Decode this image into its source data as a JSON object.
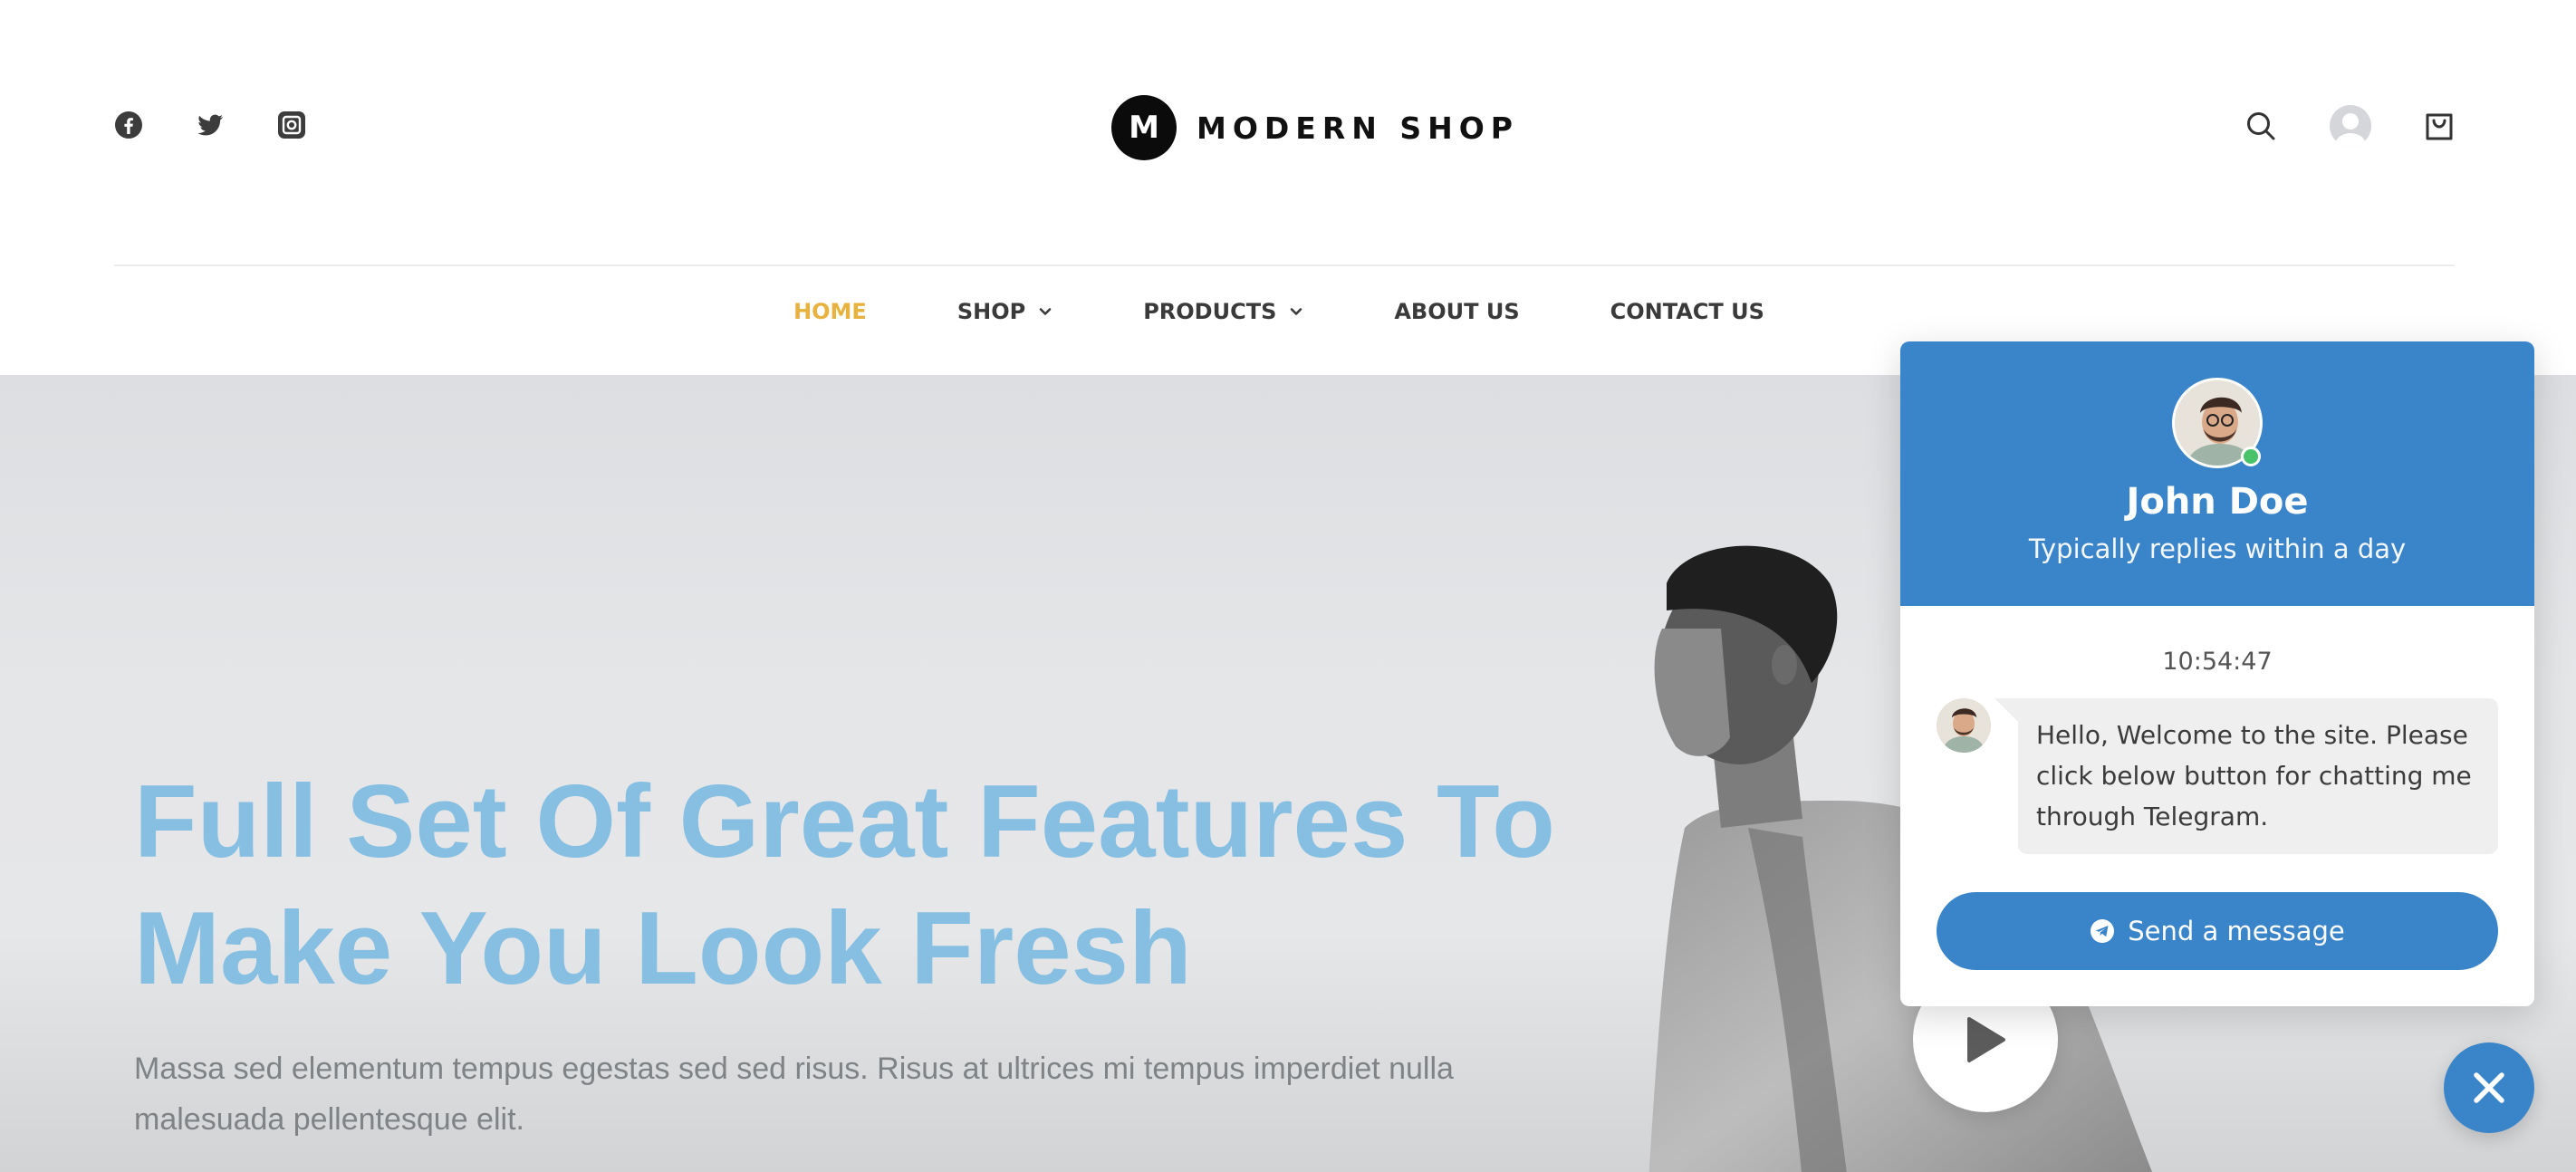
{
  "header": {
    "socials": [
      {
        "icon": "facebook-icon"
      },
      {
        "icon": "twitter-icon"
      },
      {
        "icon": "instagram-icon"
      }
    ],
    "brand": {
      "mark": "M",
      "name": "MODERN SHOP"
    },
    "actions": [
      {
        "icon": "search-icon"
      },
      {
        "icon": "user-avatar-icon"
      },
      {
        "icon": "shopping-bag-icon"
      }
    ]
  },
  "nav": {
    "items": [
      {
        "label": "HOME",
        "active": true
      },
      {
        "label": "SHOP",
        "dropdown": true
      },
      {
        "label": "PRODUCTS",
        "dropdown": true
      },
      {
        "label": "ABOUT US"
      },
      {
        "label": "CONTACT US"
      }
    ],
    "active_color": "#e8b23e"
  },
  "hero": {
    "title": "Full Set Of Great Features To Make You Look Fresh",
    "text": "Massa sed elementum tempus egestas sed sed risus. Risus at ultrices mi tempus imperdiet nulla malesuada pellentesque elit.",
    "title_color": "#86bfe2"
  },
  "chat": {
    "agent_name": "John Doe",
    "agent_status": "Typically replies within a day",
    "time": "10:54:47",
    "message": "Hello, Welcome to the site. Please click below button for chatting me through Telegram.",
    "button_label": "Send a message",
    "accent_color": "#3a84c9",
    "online_color": "#4ac26b"
  }
}
